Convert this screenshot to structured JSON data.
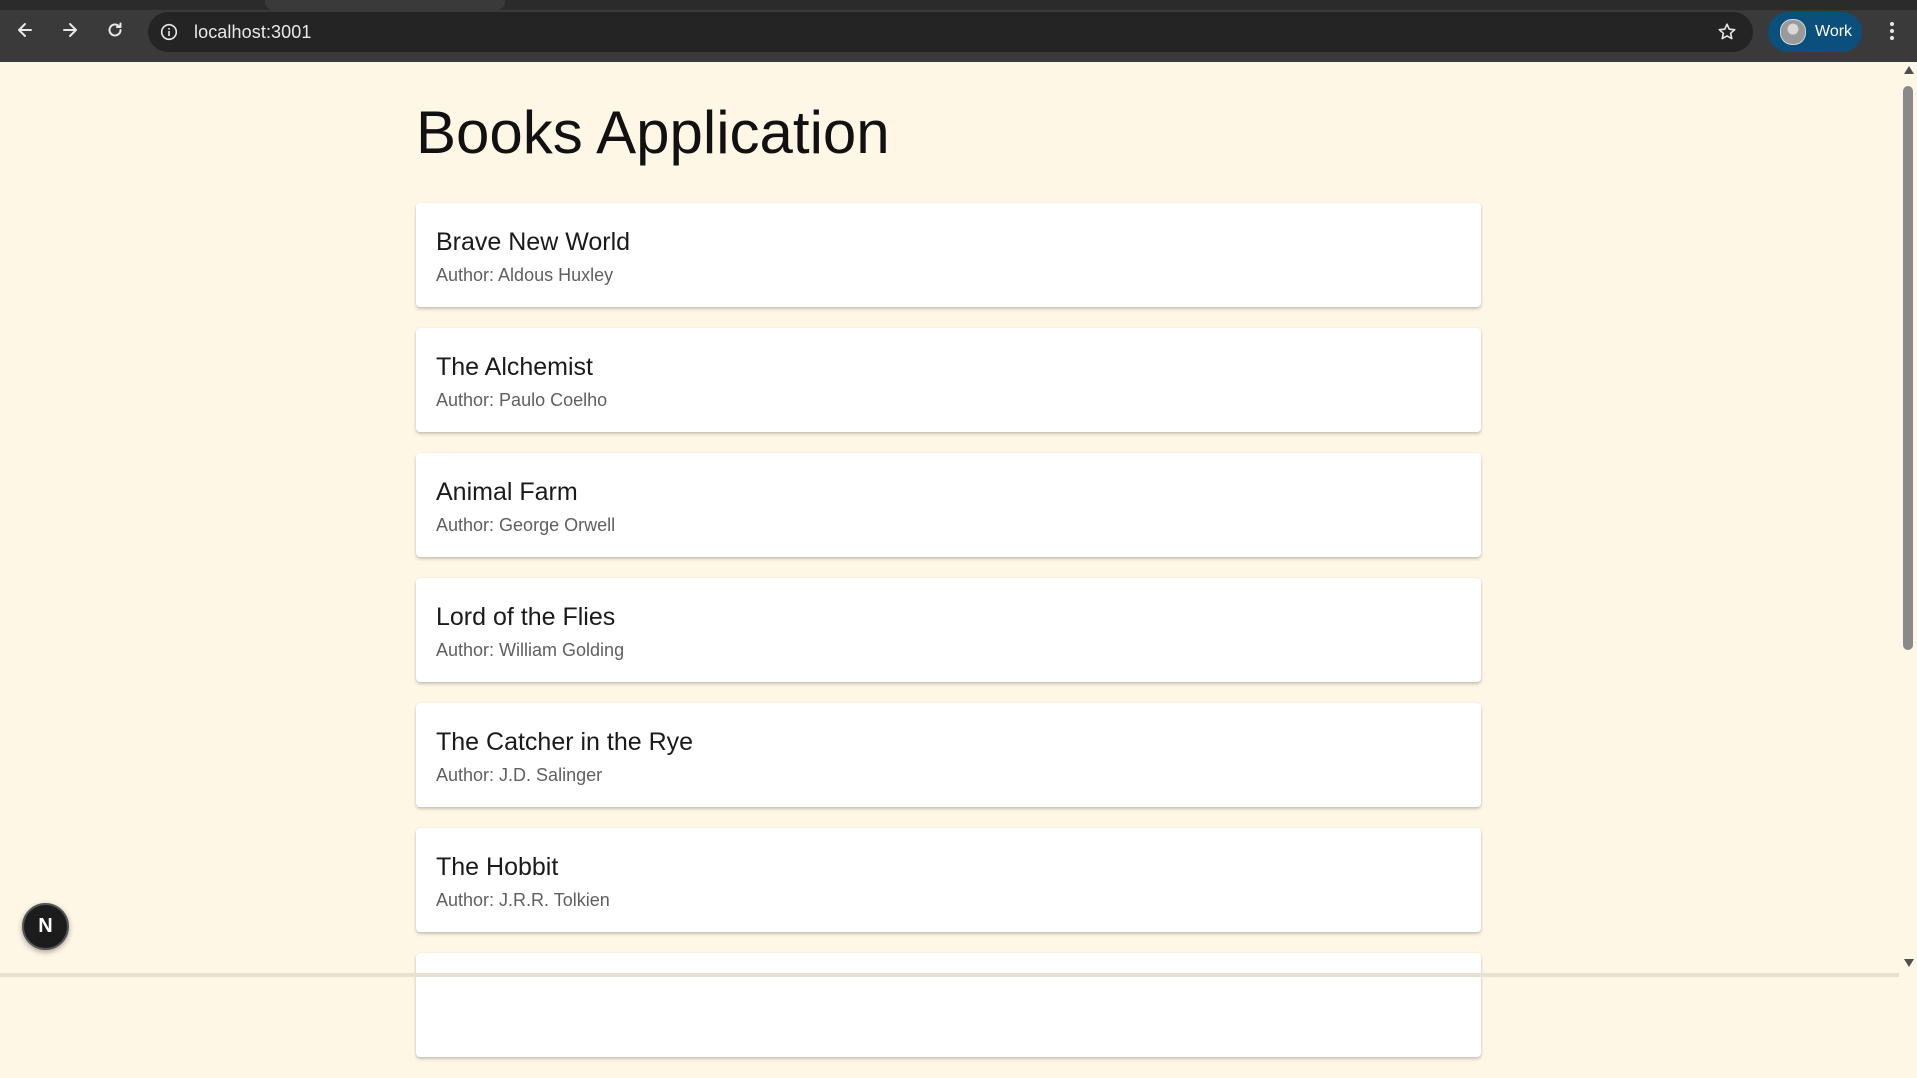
{
  "browser": {
    "url": "localhost:3001",
    "profile_label": "Work",
    "icons": {
      "back": "back-arrow-icon",
      "forward": "forward-arrow-icon",
      "reload": "reload-icon",
      "site_info": "site-info-icon",
      "bookmark": "star-icon",
      "menu": "kebab-menu-icon"
    }
  },
  "page": {
    "title": "Books Application",
    "author_prefix": "Author: ",
    "books": [
      {
        "title": "Brave New World",
        "author": "Aldous Huxley"
      },
      {
        "title": "The Alchemist",
        "author": "Paulo Coelho"
      },
      {
        "title": "Animal Farm",
        "author": "George Orwell"
      },
      {
        "title": "Lord of the Flies",
        "author": "William Golding"
      },
      {
        "title": "The Catcher in the Rye",
        "author": "J.D. Salinger"
      },
      {
        "title": "The Hobbit",
        "author": "J.R.R. Tolkien"
      },
      {
        "title": "",
        "author": ""
      }
    ]
  },
  "dev_badge": {
    "letter": "N"
  },
  "colors": {
    "page_background": "#fff7e6",
    "toolbar": "#3a3a3a",
    "omnibox": "#242424",
    "profile_chip": "#0b4f7c",
    "card": "#ffffff"
  }
}
